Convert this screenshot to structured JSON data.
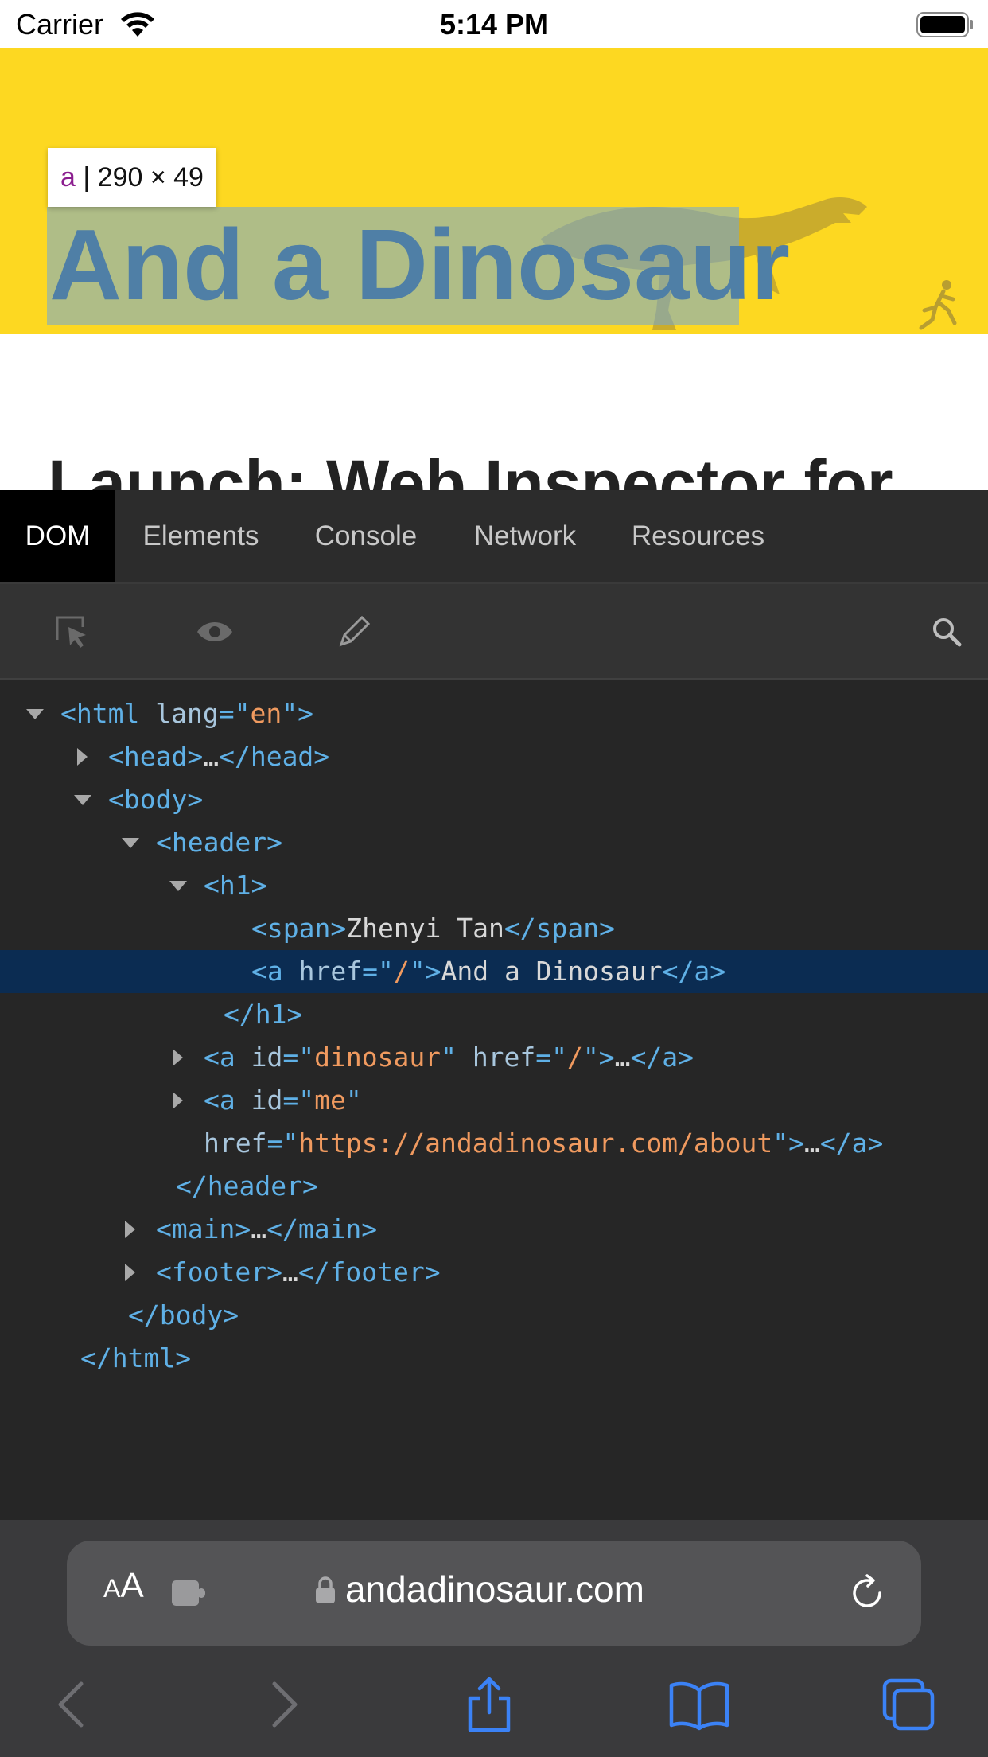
{
  "status_bar": {
    "carrier": "Carrier",
    "time": "5:14 PM",
    "wifi_icon": "wifi-icon",
    "battery_icon": "battery-icon"
  },
  "web_page": {
    "site_title": "And a Dinosaur",
    "inspect_tooltip": {
      "tag": "a",
      "separator": " | ",
      "size": "290 × 49"
    },
    "post_title": "Launch: Web Inspector for",
    "banner_color": "#fdd821"
  },
  "inspector": {
    "tabs": [
      {
        "label": "DOM",
        "active": true
      },
      {
        "label": "Elements",
        "active": false
      },
      {
        "label": "Console",
        "active": false
      },
      {
        "label": "Network",
        "active": false
      },
      {
        "label": "Resources",
        "active": false
      }
    ],
    "toolbar_icons": [
      "select-element-icon",
      "eye-icon",
      "pencil-icon",
      "search-icon"
    ],
    "dom_rows": {
      "r0": {
        "open": "<html ",
        "attr1": "lang",
        "eq": "=\"",
        "val1": "en",
        "close": "\">"
      },
      "r1": {
        "open": "<head>",
        "dots": "…",
        "close": "</head>"
      },
      "r2": {
        "open": "<body>"
      },
      "r3": {
        "open": "<header>"
      },
      "r4": {
        "open": "<h1>"
      },
      "r5": {
        "open": "<span>",
        "text": "Zhenyi Tan",
        "close": "</span>"
      },
      "r6": {
        "open": "<a ",
        "attr1": "href",
        "eq": "=\"",
        "val1": "/",
        "mid": "\">",
        "text": "And a Dinosaur",
        "close": "</a>"
      },
      "r7": {
        "close": "</h1>"
      },
      "r8": {
        "open": "<a ",
        "attr1": "id",
        "eq1": "=\"",
        "val1": "dinosaur",
        "q1": "\" ",
        "attr2": "href",
        "eq2": "=\"",
        "val2": "/",
        "mid": "\">",
        "dots": "…",
        "close": "</a>"
      },
      "r9": {
        "open": "<a ",
        "attr1": "id",
        "eq1": "=\"",
        "val1": "me",
        "q1": "\""
      },
      "r10": {
        "attr2": "href",
        "eq2": "=\"",
        "val2": "https://andadinosaur.com/about",
        "mid": "\">",
        "dots": "…",
        "close": "</a>"
      },
      "r11": {
        "close": "</header>"
      },
      "r12": {
        "open": "<main>",
        "dots": "…",
        "close": "</main>"
      },
      "r13": {
        "open": "<footer>",
        "dots": "…",
        "close": "</footer>"
      },
      "r14": {
        "close": "</body>"
      },
      "r15": {
        "close": "</html>"
      }
    },
    "selected_row": 6
  },
  "safari": {
    "text_size_label": {
      "small": "A",
      "large": "A"
    },
    "url": "andadinosaur.com",
    "icons": [
      "extension-icon",
      "lock-icon",
      "reload-icon",
      "back-icon",
      "forward-icon",
      "share-icon",
      "bookmarks-icon",
      "tabs-icon"
    ]
  },
  "colors": {
    "tag": "#5fb0e6",
    "attr_value": "#f09a5f",
    "selection": "#0b2c52",
    "accent_blue": "#3b82f6"
  }
}
